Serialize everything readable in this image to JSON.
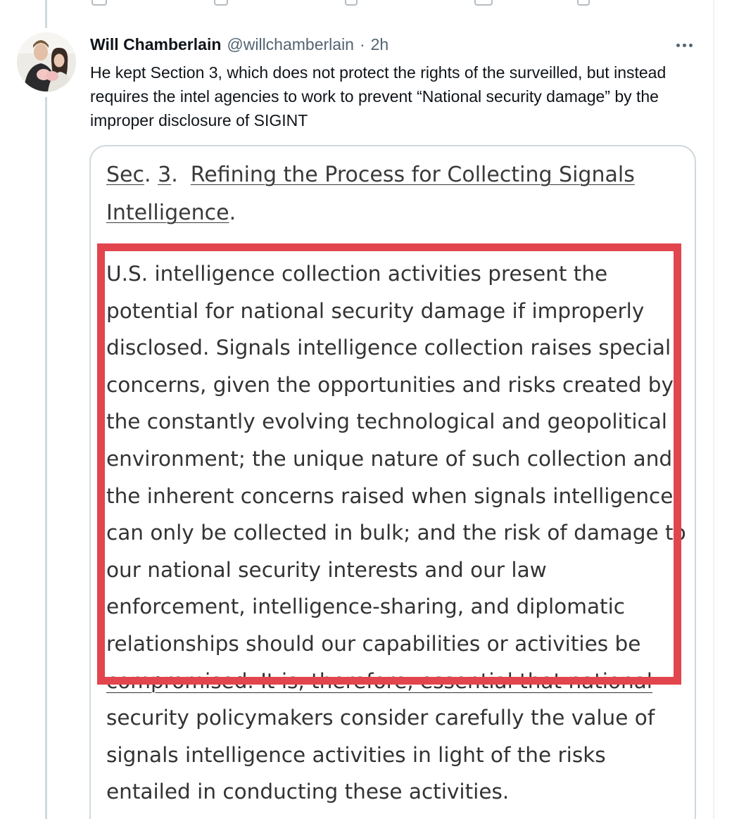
{
  "tweet": {
    "author_name": "Will Chamberlain",
    "author_handle": "@willchamberlain",
    "separator": "·",
    "time": "2h",
    "text": "He kept Section 3, which does not protect the rights of the surveilled, but instead requires the intel agencies to work to prevent “National security damage” by the improper disclosure of SIGINT"
  },
  "document_image": {
    "heading": {
      "sec": "Sec",
      "sec_period": ".",
      "number": "3",
      "number_period": ".",
      "title_line1": "Refining the Process for Collecting Signals",
      "title_line2": "Intelligence",
      "title_period": "."
    },
    "lines": [
      "U.S. intelligence collection activities present the",
      "potential for national security damage if improperly",
      "disclosed.  Signals intelligence collection raises special",
      "concerns, given the opportunities and risks created by",
      "the constantly evolving technological and geopolitical",
      "environment; the unique nature of such collection and",
      "the inherent concerns raised when signals intelligence",
      "can only be collected in bulk; and the risk of damage to",
      "our national security interests and our law",
      "enforcement, intelligence-sharing, and diplomatic",
      "relationships should our capabilities or activities be",
      "compromised.  It is, therefore, essential that national",
      "security policymakers consider carefully the value of",
      "signals intelligence activities in light of the risks",
      "entailed in conducting these activities."
    ],
    "highlight_color": "#e2454e"
  }
}
